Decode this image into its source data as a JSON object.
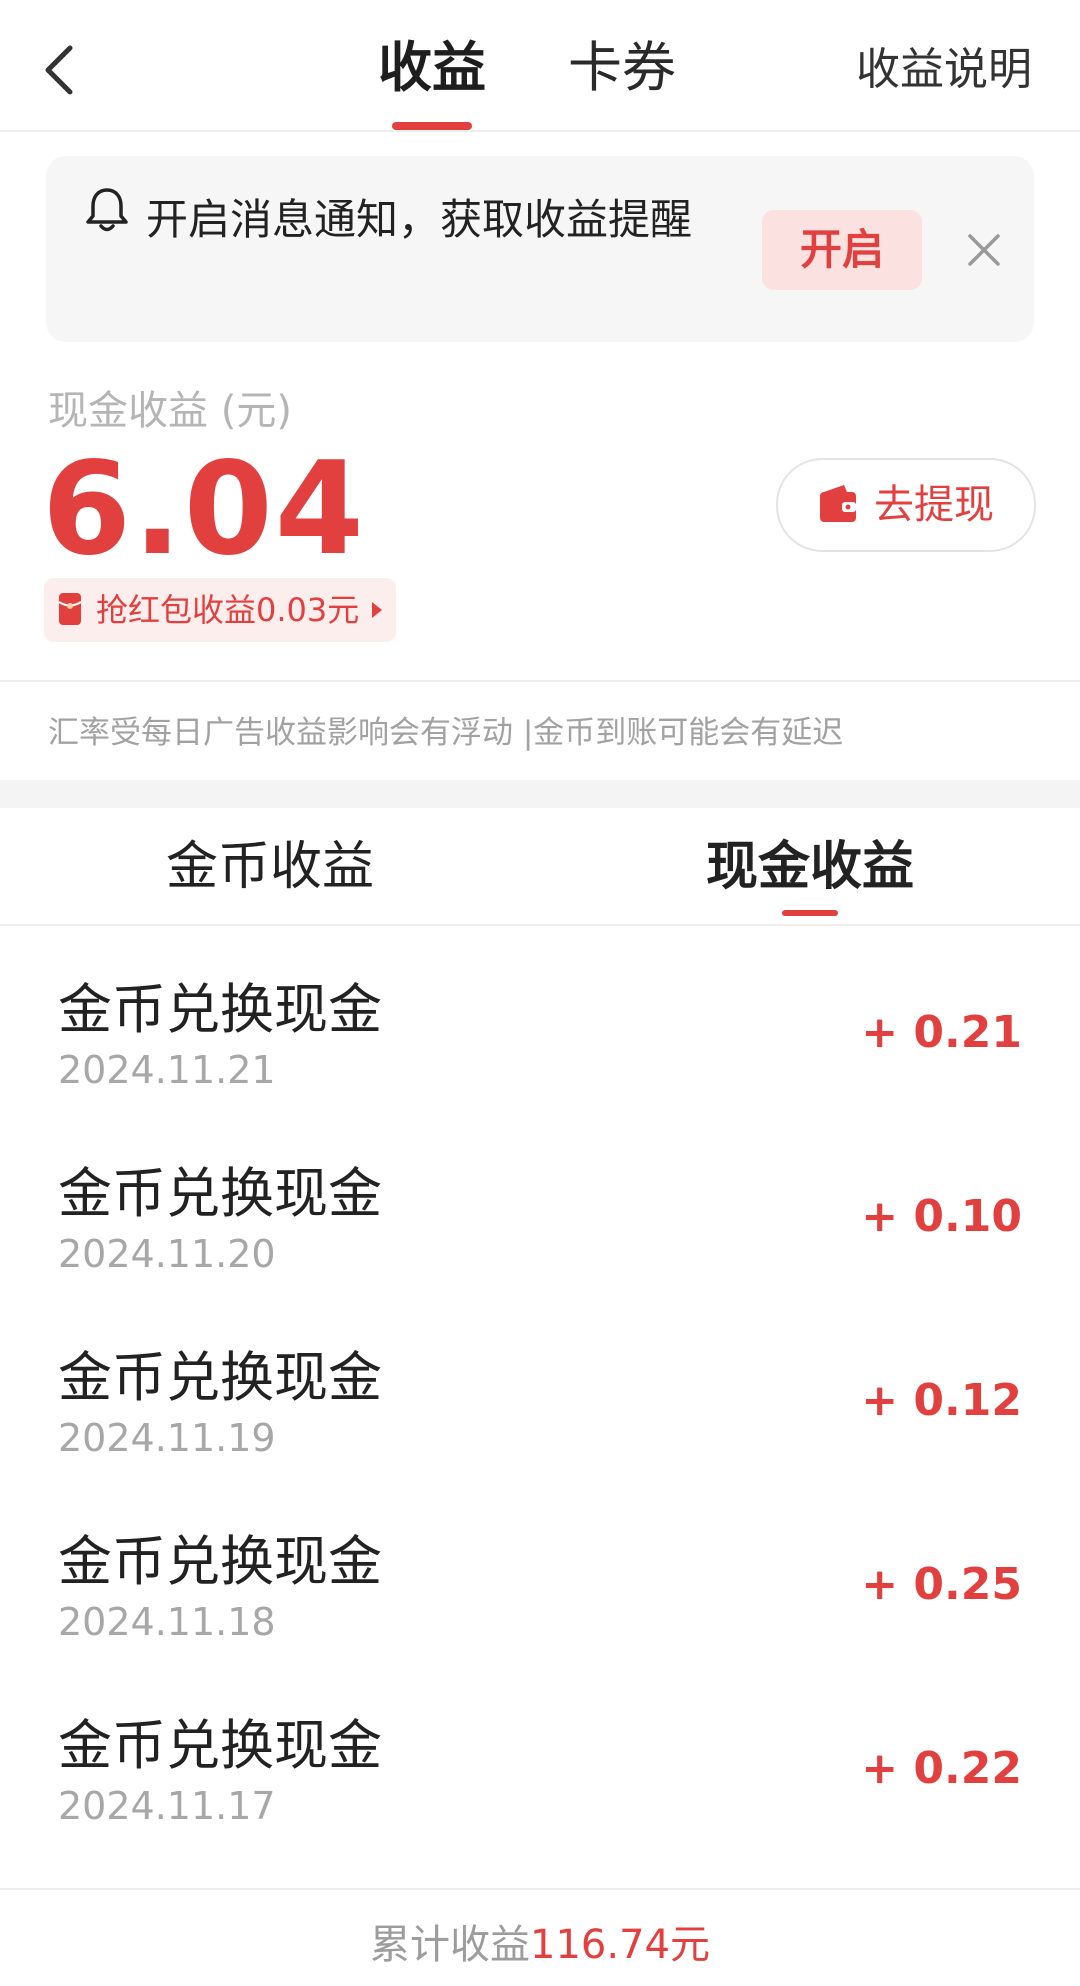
{
  "header": {
    "tabs": [
      {
        "label": "收益",
        "active": true
      },
      {
        "label": "卡券",
        "active": false
      }
    ],
    "explain_label": "收益说明"
  },
  "notice": {
    "text": "开启消息通知，获取收益提醒",
    "open_label": "开启"
  },
  "balance": {
    "label": "现金收益 (元)",
    "amount": "6.04",
    "withdraw_label": "去提现",
    "redpack_label": "抢红包收益0.03元"
  },
  "disclaimer": "汇率受每日广告收益影响会有浮动 |金币到账可能会有延迟",
  "subtabs": [
    {
      "label": "金币收益",
      "active": false
    },
    {
      "label": "现金收益",
      "active": true
    }
  ],
  "records": [
    {
      "title": "金币兑换现金",
      "date": "2024.11.21",
      "amount": "+ 0.21"
    },
    {
      "title": "金币兑换现金",
      "date": "2024.11.20",
      "amount": "+ 0.10"
    },
    {
      "title": "金币兑换现金",
      "date": "2024.11.19",
      "amount": "+ 0.12"
    },
    {
      "title": "金币兑换现金",
      "date": "2024.11.18",
      "amount": "+ 0.25"
    },
    {
      "title": "金币兑换现金",
      "date": "2024.11.17",
      "amount": "+ 0.22"
    }
  ],
  "footer": {
    "label": "累计收益",
    "value": "116.74元"
  },
  "icons": {
    "back": "chevron-left-icon",
    "bell": "bell-icon",
    "close": "close-icon",
    "wallet": "wallet-icon",
    "redpack": "red-envelope-icon",
    "arrow": "caret-right-icon"
  },
  "colors": {
    "accent": "#e2403f",
    "accent_light": "#fbe1e0",
    "muted_text": "#a7a7a7",
    "banner_bg": "#f6f6f6"
  }
}
